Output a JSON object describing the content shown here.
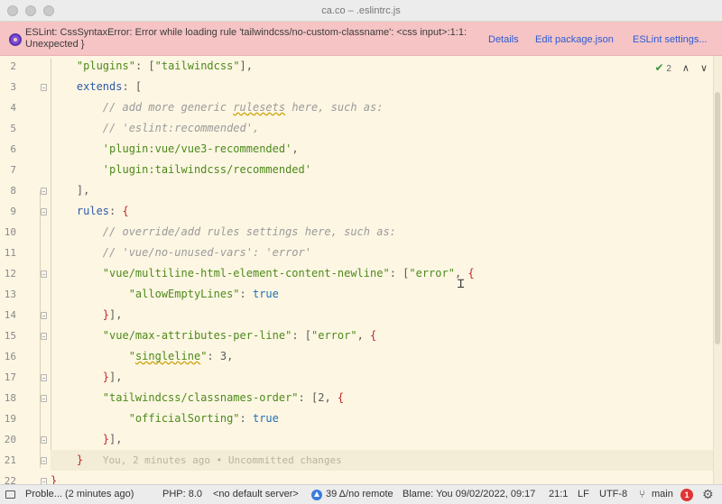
{
  "window": {
    "title": "ca.co – .eslintrc.js"
  },
  "notification": {
    "message": "ESLint: CssSyntaxError: Error while loading rule 'tailwindcss/no-custom-classname': <css input>:1:1: Unexpected }",
    "actions": [
      "Details",
      "Edit package.json",
      "ESLint settings..."
    ]
  },
  "inspection": {
    "count": "2"
  },
  "lines": [
    {
      "num": "2",
      "tokens": [
        [
          "p",
          "    "
        ],
        [
          "s",
          "\"plugins\""
        ],
        [
          "p",
          ": ["
        ],
        [
          "s",
          "\"tailwindcss\""
        ],
        [
          "p",
          "],"
        ]
      ]
    },
    {
      "num": "3",
      "tokens": [
        [
          "p",
          "    "
        ],
        [
          "k",
          "extends"
        ],
        [
          "p",
          ": ["
        ]
      ]
    },
    {
      "num": "4",
      "tokens": [
        [
          "p",
          "        "
        ],
        [
          "c",
          "// add more generic "
        ],
        [
          "csq",
          "rulesets"
        ],
        [
          "c",
          " here, such as:"
        ]
      ]
    },
    {
      "num": "5",
      "tokens": [
        [
          "p",
          "        "
        ],
        [
          "c",
          "// 'eslint:recommended',"
        ]
      ]
    },
    {
      "num": "6",
      "tokens": [
        [
          "p",
          "        "
        ],
        [
          "s",
          "'plugin:vue/vue3-recommended'"
        ],
        [
          "p",
          ","
        ]
      ]
    },
    {
      "num": "7",
      "tokens": [
        [
          "p",
          "        "
        ],
        [
          "s",
          "'plugin:tailwindcss/recommended'"
        ]
      ]
    },
    {
      "num": "8",
      "tokens": [
        [
          "p",
          "    ],"
        ]
      ]
    },
    {
      "num": "9",
      "tokens": [
        [
          "p",
          "    "
        ],
        [
          "k",
          "rules"
        ],
        [
          "p",
          ": "
        ],
        [
          "r",
          "{"
        ]
      ]
    },
    {
      "num": "10",
      "tokens": [
        [
          "p",
          "        "
        ],
        [
          "c",
          "// override/add rules settings here, such as:"
        ]
      ]
    },
    {
      "num": "11",
      "tokens": [
        [
          "p",
          "        "
        ],
        [
          "c",
          "// 'vue/no-unused-vars': 'error'"
        ]
      ]
    },
    {
      "num": "12",
      "tokens": [
        [
          "p",
          "        "
        ],
        [
          "s",
          "\"vue/multiline-html-element-content-newline\""
        ],
        [
          "p",
          ": ["
        ],
        [
          "s",
          "\"error\""
        ],
        [
          "p",
          ", "
        ],
        [
          "r",
          "{"
        ]
      ]
    },
    {
      "num": "13",
      "tokens": [
        [
          "p",
          "            "
        ],
        [
          "s",
          "\"allowEmptyLines\""
        ],
        [
          "p",
          ": "
        ],
        [
          "b",
          "true"
        ]
      ]
    },
    {
      "num": "14",
      "tokens": [
        [
          "p",
          "        "
        ],
        [
          "r",
          "}"
        ],
        [
          "p",
          "],"
        ]
      ]
    },
    {
      "num": "15",
      "tokens": [
        [
          "p",
          "        "
        ],
        [
          "s",
          "\"vue/max-attributes-per-line\""
        ],
        [
          "p",
          ": ["
        ],
        [
          "s",
          "\"error\""
        ],
        [
          "p",
          ", "
        ],
        [
          "r",
          "{"
        ]
      ]
    },
    {
      "num": "16",
      "tokens": [
        [
          "p",
          "            "
        ],
        [
          "s",
          "\""
        ],
        [
          "ssq",
          "singleline"
        ],
        [
          "s",
          "\""
        ],
        [
          "p",
          ": "
        ],
        [
          "p",
          "3"
        ],
        [
          "p",
          ","
        ]
      ]
    },
    {
      "num": "17",
      "tokens": [
        [
          "p",
          "        "
        ],
        [
          "r",
          "}"
        ],
        [
          "p",
          "],"
        ]
      ]
    },
    {
      "num": "18",
      "tokens": [
        [
          "p",
          "        "
        ],
        [
          "s",
          "\"tailwindcss/classnames-order\""
        ],
        [
          "p",
          ": [2, "
        ],
        [
          "r",
          "{"
        ]
      ]
    },
    {
      "num": "19",
      "tokens": [
        [
          "p",
          "            "
        ],
        [
          "s",
          "\"officialSorting\""
        ],
        [
          "p",
          ": "
        ],
        [
          "b",
          "true"
        ]
      ]
    },
    {
      "num": "20",
      "tokens": [
        [
          "p",
          "        "
        ],
        [
          "r",
          "}"
        ],
        [
          "p",
          "],"
        ]
      ]
    },
    {
      "num": "21",
      "tokens": [
        [
          "p",
          "    "
        ],
        [
          "r",
          "}"
        ],
        [
          "p",
          "   "
        ],
        [
          "blame",
          "You, 2 minutes ago • Uncommitted changes"
        ]
      ]
    },
    {
      "num": "22",
      "tokens": [
        [
          "r",
          "}"
        ]
      ]
    }
  ],
  "status": {
    "problems": "Proble... (2 minutes ago)",
    "php": "PHP: 8.0",
    "server": "<no default server>",
    "vcs": "39 Δ/no remote",
    "blame": "Blame: You 09/02/2022, 09:17",
    "position": "21:1",
    "line_ending": "LF",
    "encoding": "UTF-8",
    "branch": "main",
    "notifications": "1"
  }
}
